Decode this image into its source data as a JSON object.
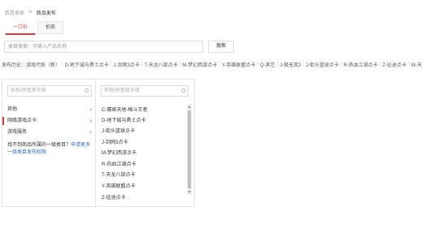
{
  "breadcrumb": {
    "home": "我是卖家",
    "separator": ">",
    "current": "商品发布"
  },
  "tabs": [
    {
      "label": "一口价",
      "active": true
    },
    {
      "label": "拍卖",
      "active": false
    }
  ],
  "search": {
    "placeholder": "类目搜索：可输入产品名称",
    "button_label": "搜索"
  },
  "history": {
    "label": "发布历史：游戏代练（新）",
    "items": [
      "D-地下城与勇士点卡",
      "J-剑网3点卡",
      "T-天龙八部点卡",
      "M-梦幻西游点卡",
      "Y-英雄联盟点卡",
      "Q-其它",
      "J-极无双2",
      "J-街头篮球点卡",
      "R-热血江湖点卡",
      "Z-征途点卡",
      "W-天"
    ],
    "separator": "|"
  },
  "left_panel": {
    "search_placeholder": "名称/拼音首字母",
    "categories": [
      {
        "label": "其他",
        "selected": false
      },
      {
        "label": "网络游戏点卡",
        "selected": true
      },
      {
        "label": "游戏服务",
        "selected": false
      }
    ],
    "chevron": "›",
    "hint_text": "找不到商品所属的一级类目？",
    "hint_link": "申请更多一级类目发布权限"
  },
  "right_panel": {
    "search_placeholder": "名称/拼音首字母",
    "items": [
      "C-赛娅天地-格斗王者",
      "D-地下城与勇士点卡",
      "J-街头篮球点卡",
      "J-剑网3点卡",
      "M-梦幻西游点卡",
      "R-热血江湖点卡",
      "T-天龙八部点卡",
      "Y-英雄联盟点卡",
      "Z-征途点卡"
    ]
  },
  "colors": {
    "accent": "#e4393c",
    "link": "#2d6bc4",
    "border": "#dddddd",
    "text": "#333333"
  }
}
